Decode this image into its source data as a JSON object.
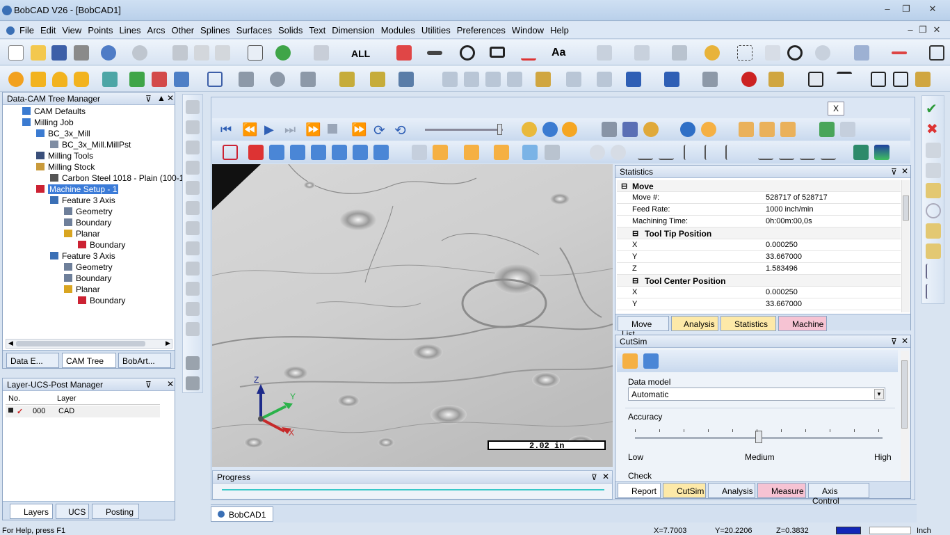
{
  "window": {
    "title": "BobCAD V26 - [BobCAD1]"
  },
  "menu": [
    "File",
    "Edit",
    "View",
    "Points",
    "Lines",
    "Arcs",
    "Other",
    "Splines",
    "Surfaces",
    "Solids",
    "Text",
    "Dimension",
    "Modules",
    "Utilities",
    "Preferences",
    "Window",
    "Help"
  ],
  "toolbar": {
    "all_label": "ALL",
    "text_label": "Aa"
  },
  "tree_manager": {
    "title": "Data-CAM Tree Manager",
    "items": [
      "CAM Defaults",
      "Milling Job",
      "BC_3x_Mill",
      "BC_3x_Mill.MillPst",
      "Milling Tools",
      "Milling Stock",
      "Carbon Steel 1018 - Plain (100-12",
      "Machine Setup - 1",
      "Feature 3 Axis",
      "Geometry",
      "Boundary",
      "Planar",
      "Boundary",
      "Feature 3 Axis",
      "Geometry",
      "Boundary",
      "Planar",
      "Boundary"
    ],
    "tabs": [
      "Data E...",
      "CAM Tree",
      "BobArt..."
    ]
  },
  "layer_manager": {
    "title": "Layer-UCS-Post Manager",
    "col_no": "No.",
    "col_layer": "Layer",
    "row_no": "000",
    "row_layer": "CAD",
    "tabs": [
      "Layers",
      "UCS",
      "Posting"
    ]
  },
  "viewport": {
    "close": "X",
    "scale": "2.02 in",
    "axis_x": "X",
    "axis_y": "Y",
    "axis_z": "Z"
  },
  "progress": {
    "title": "Progress",
    "value": 1.0
  },
  "statistics": {
    "title": "Statistics",
    "move_header": "Move",
    "rows": [
      [
        "Move #:",
        "528717 of 528717"
      ],
      [
        "Feed Rate:",
        "1000 inch/min"
      ],
      [
        "Machining Time:",
        "0h:00m:00,0s"
      ]
    ],
    "tip_header": "Tool Tip Position",
    "tip": [
      [
        "X",
        "0.000250"
      ],
      [
        "Y",
        "33.667000"
      ],
      [
        "Z",
        "1.583496"
      ]
    ],
    "center_header": "Tool Center Position",
    "center": [
      [
        "X",
        "0.000250"
      ],
      [
        "Y",
        "33.667000"
      ]
    ],
    "tabs": [
      "Move List",
      "Analysis",
      "Statistics",
      "Machine"
    ]
  },
  "cutsim": {
    "title": "CutSim",
    "data_model_label": "Data model",
    "data_model_value": "Automatic",
    "accuracy_label": "Accuracy",
    "accuracy_value": 0.5,
    "low": "Low",
    "medium": "Medium",
    "high": "High",
    "check_label": "Check",
    "tabs": [
      "Report",
      "CutSim",
      "Analysis",
      "Measure",
      "Axis Control"
    ]
  },
  "document_tab": "BobCAD1",
  "status": {
    "help": "For Help, press F1",
    "x": "X=7.7003",
    "y": "Y=20.2206",
    "z": "Z=0.3832",
    "units": "Inch"
  }
}
